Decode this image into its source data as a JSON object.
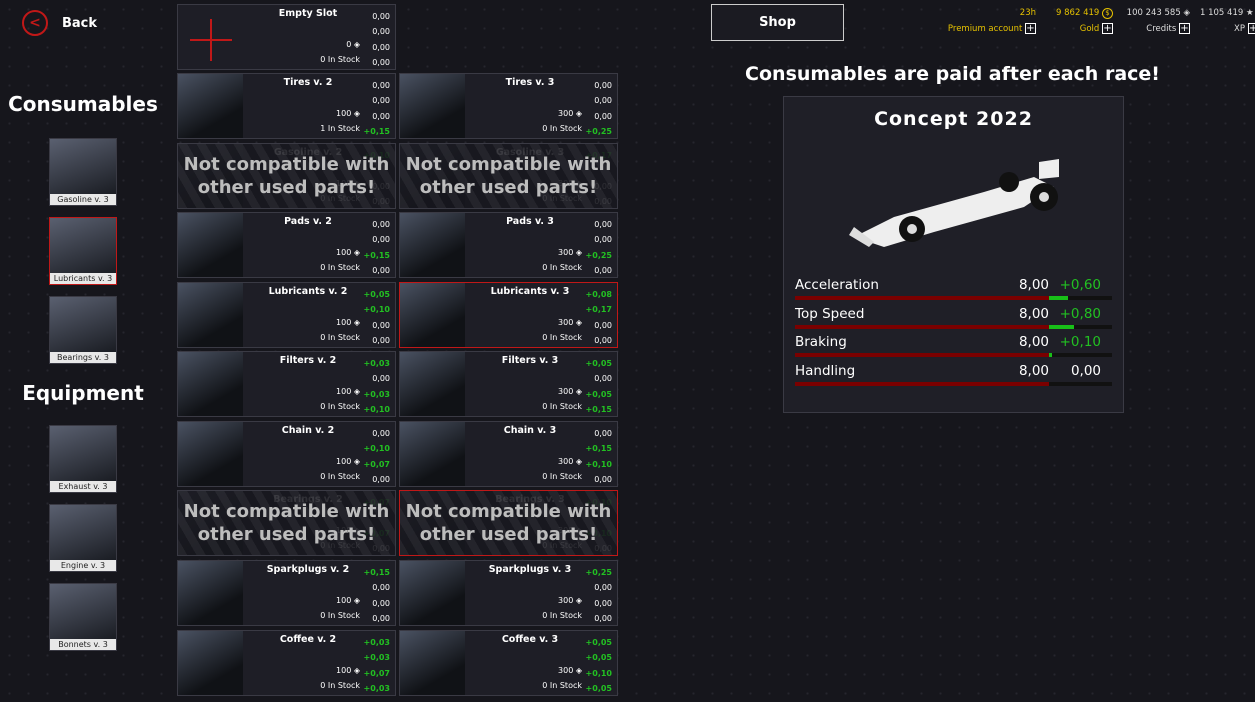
{
  "back_label": "Back",
  "sidebar": {
    "consumables_heading": "Consumables",
    "equipment_heading": "Equipment",
    "consumables": [
      {
        "label": "Gasoline v. 3"
      },
      {
        "label": "Lubricants v. 3",
        "selected": true
      },
      {
        "label": "Bearings v. 3"
      }
    ],
    "equipment": [
      {
        "label": "Exhaust v. 3"
      },
      {
        "label": "Engine v. 3"
      },
      {
        "label": "Bonnets v. 3"
      }
    ]
  },
  "incompatible_text": [
    "Not compatible with",
    "other used parts!"
  ],
  "cards": [
    {
      "title": "Empty Slot",
      "price": "0",
      "stock": "0 In Stock",
      "vals": [
        "0,00",
        "0,00",
        "0,00",
        "0,00"
      ]
    },
    null,
    {
      "title": "Tires v. 2",
      "price": "100",
      "stock": "1 In Stock",
      "vals": [
        "0,00",
        "0,00",
        "0,00",
        "+0,15"
      ]
    },
    {
      "title": "Tires v. 3",
      "price": "300",
      "stock": "0 In Stock",
      "vals": [
        "0,00",
        "0,00",
        "0,00",
        "+0,25"
      ]
    },
    {
      "title": "Gasoline v. 2",
      "price": "100",
      "stock": "0 In Stock",
      "vals": [
        "+0,10",
        "",
        "0,00",
        "0,00"
      ],
      "incompatible": true
    },
    {
      "title": "Gasoline v. 3",
      "price": "300",
      "stock": "0 In Stock",
      "vals": [
        "+0,17",
        "",
        "0,00",
        "0,00"
      ],
      "incompatible": true
    },
    {
      "title": "Pads v. 2",
      "price": "100",
      "stock": "0 In Stock",
      "vals": [
        "0,00",
        "0,00",
        "+0,15",
        "0,00"
      ]
    },
    {
      "title": "Pads v. 3",
      "price": "300",
      "stock": "0 In Stock",
      "vals": [
        "0,00",
        "0,00",
        "+0,25",
        "0,00"
      ]
    },
    {
      "title": "Lubricants v. 2",
      "price": "100",
      "stock": "0 In Stock",
      "vals": [
        "+0,05",
        "+0,10",
        "0,00",
        "0,00"
      ]
    },
    {
      "title": "Lubricants v. 3",
      "price": "300",
      "stock": "0 In Stock",
      "vals": [
        "+0,08",
        "+0,17",
        "0,00",
        "0,00"
      ],
      "selected": true
    },
    {
      "title": "Filters v. 2",
      "price": "100",
      "stock": "0 In Stock",
      "vals": [
        "+0,03",
        "0,00",
        "+0,03",
        "+0,10"
      ]
    },
    {
      "title": "Filters v. 3",
      "price": "300",
      "stock": "0 In Stock",
      "vals": [
        "+0,05",
        "0,00",
        "+0,05",
        "+0,15"
      ]
    },
    {
      "title": "Chain v. 2",
      "price": "100",
      "stock": "0 In Stock",
      "vals": [
        "0,00",
        "+0,10",
        "+0,07",
        "0,00"
      ]
    },
    {
      "title": "Chain v. 3",
      "price": "300",
      "stock": "0 In Stock",
      "vals": [
        "0,00",
        "+0,15",
        "+0,10",
        "0,00"
      ]
    },
    {
      "title": "Bearings v. 2",
      "price": "100",
      "stock": "0 In Stock",
      "vals": [
        "+0,07",
        "",
        "+0,07",
        "0,00"
      ],
      "incompatible": true
    },
    {
      "title": "Bearings v. 3",
      "price": "300",
      "stock": "0 In Stock",
      "vals": [
        "+0,10",
        "",
        "+0,10",
        "0,00"
      ],
      "incompatible": true,
      "selected": true
    },
    {
      "title": "Sparkplugs v. 2",
      "price": "100",
      "stock": "0 In Stock",
      "vals": [
        "+0,15",
        "0,00",
        "0,00",
        "0,00"
      ]
    },
    {
      "title": "Sparkplugs v. 3",
      "price": "300",
      "stock": "0 In Stock",
      "vals": [
        "+0,25",
        "0,00",
        "0,00",
        "0,00"
      ]
    },
    {
      "title": "Coffee v. 2",
      "price": "100",
      "stock": "0 In Stock",
      "vals": [
        "+0,03",
        "+0,03",
        "+0,07",
        "+0,03"
      ]
    },
    {
      "title": "Coffee v. 3",
      "price": "300",
      "stock": "0 In Stock",
      "vals": [
        "+0,05",
        "+0,05",
        "+0,10",
        "+0,05"
      ]
    }
  ],
  "shop_label": "Shop",
  "currencies": {
    "premium_time": "23h",
    "premium_label": "Premium account",
    "gold": "9 862 419",
    "gold_label": "Gold",
    "credits": "100 243 585",
    "credits_label": "Credits",
    "xp": "1 105 419",
    "xp_label": "XP"
  },
  "headline": "Consumables are paid after each race!",
  "car": {
    "name": "Concept 2022",
    "stat_max": 10,
    "stats": [
      {
        "name": "Acceleration",
        "value": "8,00",
        "delta": "+0,60",
        "base": 8,
        "bonus": 0.6
      },
      {
        "name": "Top Speed",
        "value": "8,00",
        "delta": "+0,80",
        "base": 8,
        "bonus": 0.8
      },
      {
        "name": "Braking",
        "value": "8,00",
        "delta": "+0,10",
        "base": 8,
        "bonus": 0.1
      },
      {
        "name": "Handling",
        "value": "8,00",
        "delta": "0,00",
        "base": 8,
        "bonus": 0
      }
    ]
  },
  "colors": {
    "accent_red": "#c01818",
    "bonus_green": "#22c022",
    "gold": "#e6c200"
  }
}
